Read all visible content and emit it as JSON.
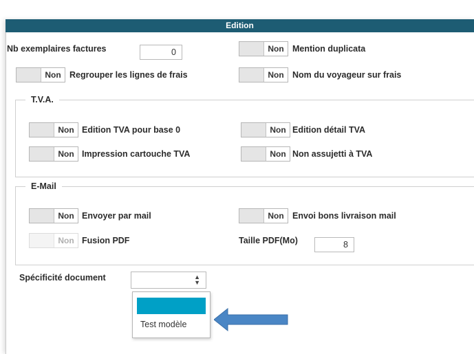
{
  "section": {
    "title": "Edition"
  },
  "toggle_state": "Non",
  "top": {
    "nb_exemplaires_label": "Nb exemplaires factures",
    "nb_exemplaires_value": "0",
    "mention_duplicata": "Mention duplicata",
    "regrouper_frais": "Regrouper les lignes de frais",
    "nom_voyageur": "Nom du voyageur sur frais"
  },
  "tva": {
    "legend": "T.V.A.",
    "edition_base0": "Edition TVA pour base 0",
    "edition_detail": "Edition détail TVA",
    "impression_cartouche": "Impression cartouche TVA",
    "non_assujetti": "Non assujetti à TVA"
  },
  "email": {
    "legend": "E-Mail",
    "envoyer_mail": "Envoyer par mail",
    "envoi_bons": "Envoi bons livraison mail",
    "fusion_pdf": "Fusion PDF",
    "taille_pdf_label": "Taille PDF(Mo)",
    "taille_pdf_value": "8"
  },
  "specificite": {
    "label": "Spécificité document",
    "selected_value": "",
    "options": [
      "",
      "Test modèle"
    ]
  },
  "colors": {
    "header": "#1d5c73",
    "highlight": "#00a0c6",
    "arrow": "#4a86c5"
  },
  "icons": {
    "select_arrows": "updown-chevron-icon",
    "pointer": "left-arrow-icon"
  }
}
